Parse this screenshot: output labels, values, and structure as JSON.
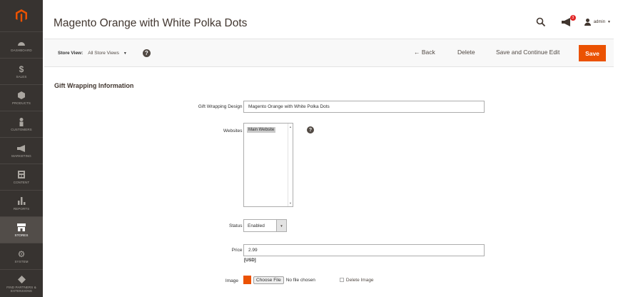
{
  "brand": {
    "accent": "#eb5202",
    "sidebar_bg": "#373330",
    "logo": "magento-logo"
  },
  "sidebar": {
    "items": [
      {
        "label": "DASHBOARD",
        "icon": "dashboard-icon"
      },
      {
        "label": "SALES",
        "icon": "dollar-icon"
      },
      {
        "label": "PRODUCTS",
        "icon": "cube-icon"
      },
      {
        "label": "CUSTOMERS",
        "icon": "person-icon"
      },
      {
        "label": "MARKETING",
        "icon": "megaphone-icon"
      },
      {
        "label": "CONTENT",
        "icon": "content-icon"
      },
      {
        "label": "REPORTS",
        "icon": "bar-chart-icon"
      },
      {
        "label": "STORES",
        "icon": "store-icon",
        "active": true
      },
      {
        "label": "SYSTEM",
        "icon": "gear-icon"
      },
      {
        "label": "FIND PARTNERS & EXTENSIONS",
        "icon": "partners-icon"
      }
    ]
  },
  "header": {
    "title": "Magento Orange with White Polka Dots",
    "notification_count": "3",
    "user": "admin"
  },
  "toolbar": {
    "store_view_label": "Store View:",
    "store_view_value": "All Store Views",
    "back_label": "Back",
    "delete_label": "Delete",
    "save_continue_label": "Save and Continue Edit",
    "save_label": "Save"
  },
  "form": {
    "section_title": "Gift Wrapping Information",
    "design_label": "Gift Wrapping Design",
    "design_value": "Magento Orange with White Polka Dots",
    "websites_label": "Websites",
    "websites_options": [
      "Main Website"
    ],
    "status_label": "Status",
    "status_value": "Enabled",
    "price_label": "Price",
    "price_value": "2.99",
    "currency": "[USD]",
    "image_label": "Image",
    "choose_file_label": "Choose File",
    "no_file_label": "No file chosen",
    "delete_image_label": "Delete Image"
  }
}
